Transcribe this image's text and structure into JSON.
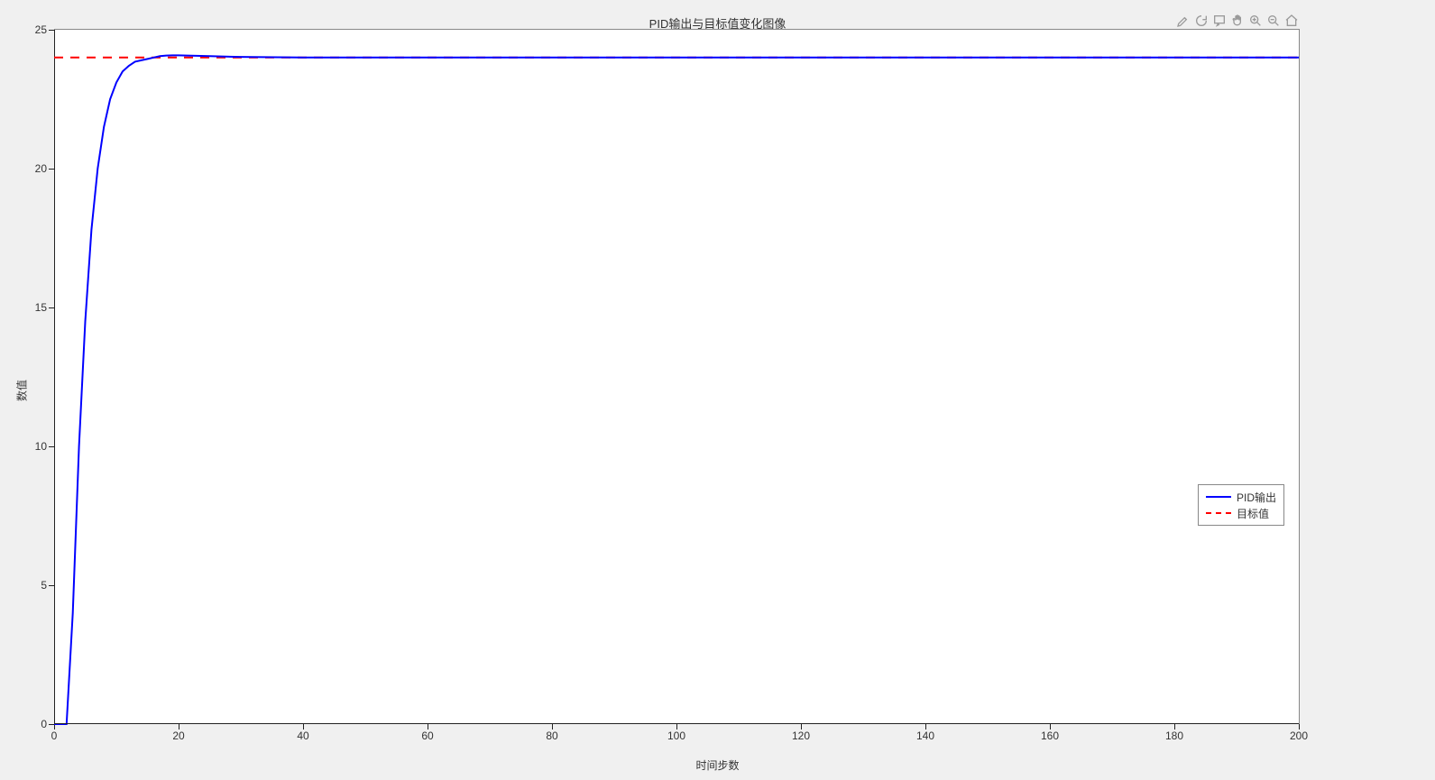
{
  "chart_data": {
    "type": "line",
    "title": "PID输出与目标值变化图像",
    "xlabel": "时间步数",
    "ylabel": "数值",
    "xlim": [
      0,
      200
    ],
    "ylim": [
      0,
      25
    ],
    "x_ticks": [
      0,
      20,
      40,
      60,
      80,
      100,
      120,
      140,
      160,
      180,
      200
    ],
    "y_ticks": [
      0,
      5,
      10,
      15,
      20,
      25
    ],
    "grid": false,
    "legend_position": "right",
    "series": [
      {
        "name": "PID输出",
        "style": "solid",
        "color": "#0000ff",
        "x": [
          0,
          1,
          2,
          3,
          4,
          5,
          6,
          7,
          8,
          9,
          10,
          11,
          12,
          13,
          14,
          15,
          16,
          17,
          18,
          19,
          20,
          25,
          30,
          40,
          50,
          60,
          80,
          100,
          120,
          140,
          160,
          180,
          200
        ],
        "y": [
          0,
          0,
          0,
          4,
          10,
          14.5,
          17.8,
          20,
          21.5,
          22.5,
          23.1,
          23.5,
          23.7,
          23.85,
          23.9,
          23.95,
          24.0,
          24.05,
          24.07,
          24.08,
          24.08,
          24.05,
          24.02,
          24.0,
          24.0,
          24.0,
          24.0,
          24.0,
          24.0,
          24.0,
          24.0,
          24.0,
          24.0
        ]
      },
      {
        "name": "目标值",
        "style": "dashed",
        "color": "#ff0000",
        "x": [
          0,
          200
        ],
        "y": [
          24,
          24
        ]
      }
    ]
  },
  "toolbar": {
    "brush": "brush",
    "rotate": "rotate",
    "datatips": "data-tips",
    "pan": "pan",
    "zoom_in": "zoom-in",
    "zoom_out": "zoom-out",
    "home": "home"
  }
}
